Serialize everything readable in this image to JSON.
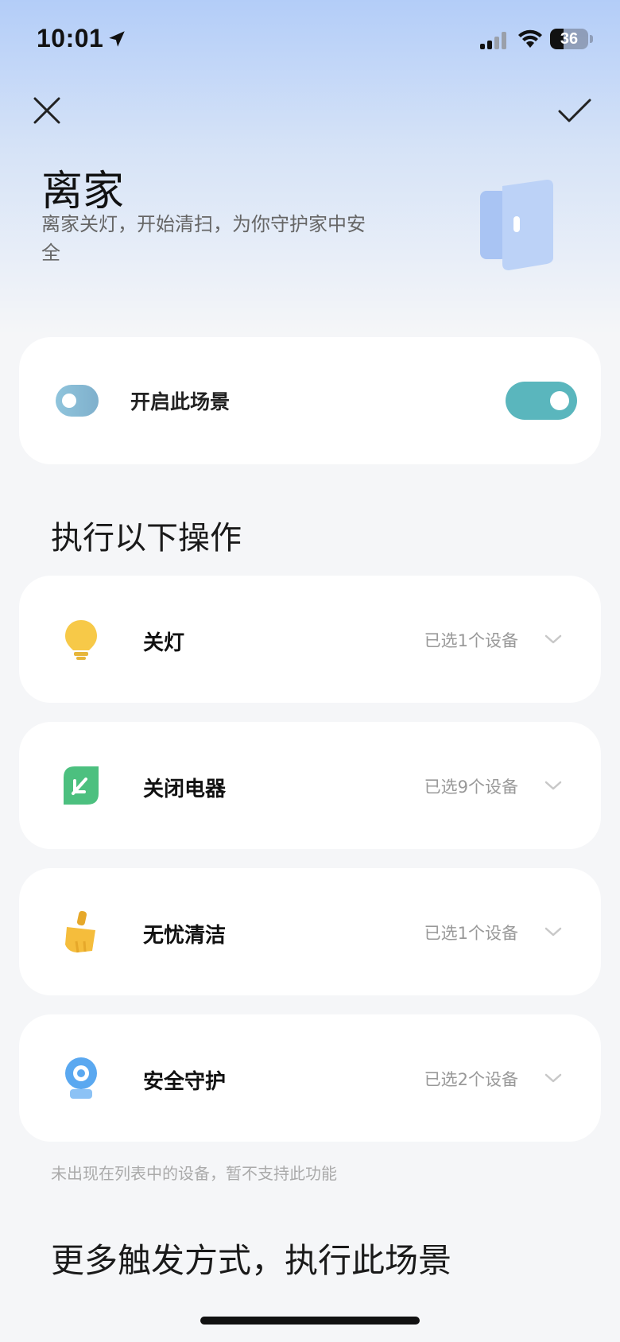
{
  "status_bar": {
    "time": "10:01",
    "battery": "36",
    "battery_level_percent": 36,
    "icons": [
      "location-arrow-icon",
      "cellular-signal-icon",
      "wifi-icon",
      "battery-icon"
    ]
  },
  "nav": {
    "close_icon": "close-icon",
    "confirm_icon": "checkmark-icon"
  },
  "scene": {
    "title": "离家",
    "description": "离家关灯，开始清扫，为你守护家中安全",
    "icon": "door-icon"
  },
  "enable_card": {
    "label": "开启此场景",
    "enabled": true,
    "icon": "toggle-small-icon"
  },
  "actions_section": {
    "title": "执行以下操作",
    "items": [
      {
        "label": "关灯",
        "count": "已选1个设备",
        "icon": "light-bulb-icon",
        "color": "#f7c948"
      },
      {
        "label": "关闭电器",
        "count": "已选9个设备",
        "icon": "leaf-power-icon",
        "color": "#4cc07f"
      },
      {
        "label": "无忧清洁",
        "count": "已选1个设备",
        "icon": "cleaning-brush-icon",
        "color": "#f5bd3c"
      },
      {
        "label": "安全守护",
        "count": "已选2个设备",
        "icon": "security-camera-icon",
        "color": "#5aa8f0"
      }
    ]
  },
  "footnote": "未出现在列表中的设备，暂不支持此功能",
  "more_triggers": {
    "title": "更多触发方式，执行此场景"
  },
  "colors": {
    "accent_toggle": "#5ab6bd",
    "card_bg": "#ffffff",
    "page_bg": "#f5f6f8"
  }
}
